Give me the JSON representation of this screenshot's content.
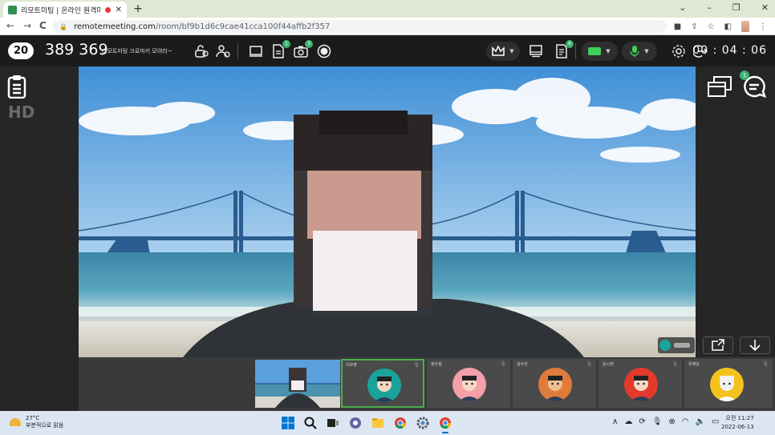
{
  "browser": {
    "tab_title": "리모트미팅 | 온라인 원격미",
    "tab_close": "✕",
    "new_tab": "+",
    "window_controls": [
      "⌄",
      "–",
      "❐",
      "✕"
    ],
    "nav_back": "←",
    "nav_forward": "→",
    "nav_reload": "C",
    "url_host": "remotemeeting.com",
    "url_path": "/room/bf9b1d6c9cae41cca100f44affb2f357"
  },
  "toolbar": {
    "participant_count": "20",
    "room_number": "389 369",
    "room_name": "리모트미팅 크로마키 모여라~",
    "doc_badge": "1",
    "capture_badge": "3",
    "share_badge": "6",
    "timer": "00 : 04 : 06"
  },
  "left_panel": {
    "hd_label": "HD"
  },
  "right_panel": {
    "chat_badge": "1"
  },
  "participants": [
    {
      "name": "이보영",
      "avatar_bg": "#1aa39a",
      "active": true
    },
    {
      "name": "정수정",
      "avatar_bg": "#f3a0a8",
      "active": false
    },
    {
      "name": "김수진",
      "avatar_bg": "#e07b39",
      "active": false
    },
    {
      "name": "윤시현",
      "avatar_bg": "#e33a2c",
      "active": false
    },
    {
      "name": "유재윤",
      "avatar_bg": "#f4c21c",
      "active": false
    }
  ],
  "taskbar": {
    "temperature": "27°C",
    "weather_desc": "부분적으로 맑음",
    "clock_time": "오전 11:27",
    "clock_date": "2022-06-13"
  },
  "colors": {
    "accent_green": "#3cb371",
    "active_border": "#4caf50",
    "app_bg": "#1b1b1b"
  }
}
